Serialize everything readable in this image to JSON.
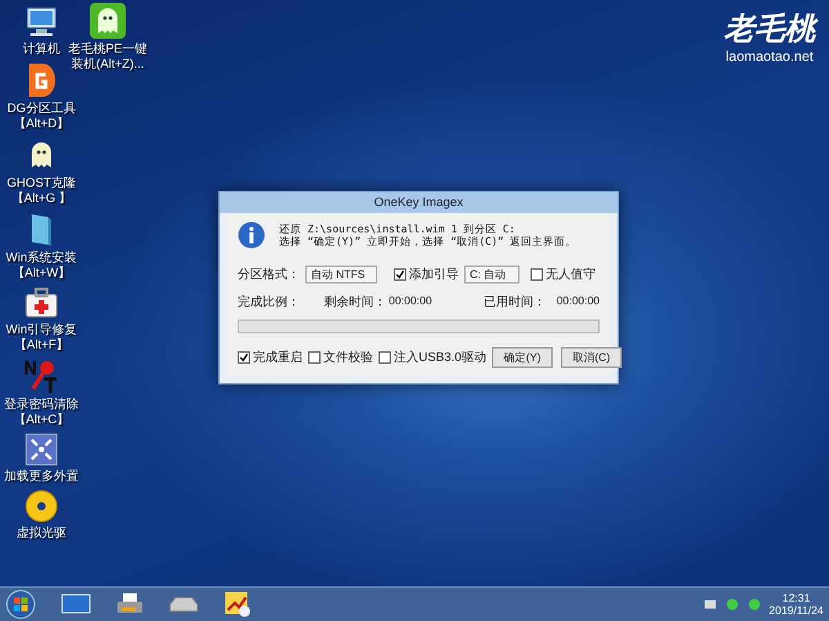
{
  "desktop_icons": [
    {
      "kind": "computer",
      "lines": [
        "计算机"
      ]
    },
    {
      "kind": "dg",
      "lines": [
        "DG分区工具",
        "【Alt+D】"
      ]
    },
    {
      "kind": "ghost",
      "lines": [
        "GHOST克隆",
        "【Alt+G 】"
      ]
    },
    {
      "kind": "installer",
      "lines": [
        "Win系统安装",
        "【Alt+W】"
      ]
    },
    {
      "kind": "repair",
      "lines": [
        "Win引导修复",
        "【Alt+F】"
      ]
    },
    {
      "kind": "password",
      "lines": [
        "登录密码清除",
        "【Alt+C】"
      ]
    },
    {
      "kind": "expand",
      "lines": [
        "加载更多外置"
      ]
    },
    {
      "kind": "disc",
      "lines": [
        "虚拟光驱"
      ]
    }
  ],
  "desktop_icons_column_2": [
    {
      "kind": "onekey",
      "lines": [
        "老毛桃PE一键",
        "装机(Alt+Z)..."
      ]
    }
  ],
  "wallpaper_logo": {
    "title": "老毛桃",
    "site": "laomaotao.net"
  },
  "dialog": {
    "title": "OneKey Imagex",
    "message": [
      "还原 Z:\\sources\\install.wim 1 到分区 C:",
      "选择 “确定(Y)” 立即开始，选择 “取消(C)” 返回主界面。"
    ],
    "format_label": "分区格式：",
    "format_value": "自动 NTFS",
    "add_boot": {
      "label": "添加引导",
      "checked": true
    },
    "drive_value": "C: 自动",
    "unattended": {
      "label": "无人值守",
      "checked": false
    },
    "progress_label": "完成比例：",
    "remaining_label": "剩余时间：",
    "remaining_value": "00:00:00",
    "elapsed_label": "已用时间：",
    "elapsed_value": "00:00:00",
    "progress": {
      "level": 0
    },
    "options": [
      {
        "label": "完成重启",
        "checked": true
      },
      {
        "label": "文件校验",
        "checked": false
      },
      {
        "label": "注入USB3.0驱动",
        "checked": false
      }
    ],
    "buttons": [
      "确定(Y)",
      "取消(C)"
    ]
  },
  "taskbar": {
    "time": "12:31",
    "date": "2019/11/24"
  }
}
